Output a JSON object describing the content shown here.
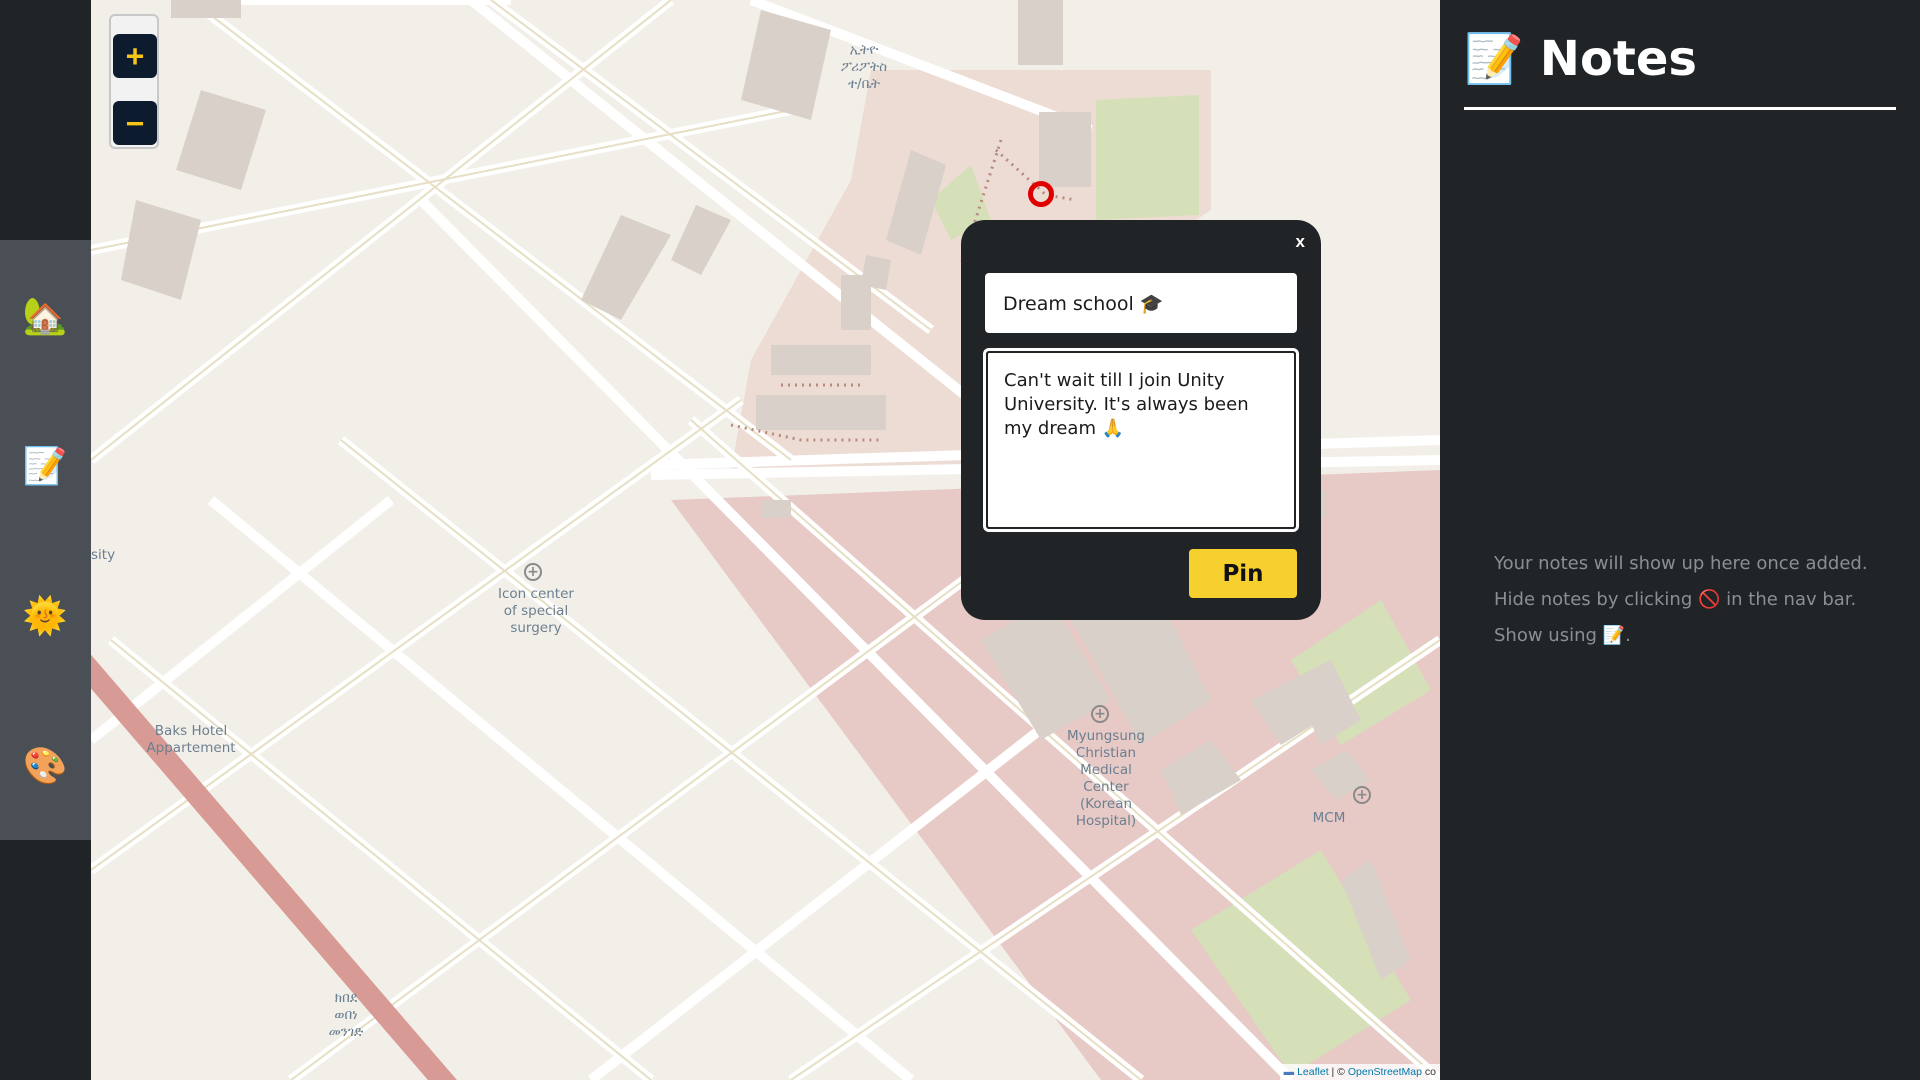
{
  "nav": {
    "items": [
      {
        "name": "home",
        "icon": "🏡"
      },
      {
        "name": "notes",
        "icon": "📝"
      },
      {
        "name": "theme",
        "icon": "🌞"
      },
      {
        "name": "palette",
        "icon": "🎨"
      }
    ]
  },
  "map": {
    "zoom_in_label": "+",
    "zoom_out_label": "−",
    "labels": {
      "amharic_top": "ኢትዮ\nፖሪፖትስ\nተ/ቤት",
      "icon_center": "Icon center\nof special\nsurgery",
      "baks_hotel": "Baks Hotel\nAppartement",
      "myungsung": "Myungsung\nChristian\nMedical\nCenter\n(Korean\nHospital)",
      "mcm": "MCM",
      "amharic_bottom": "ክበደ\nወበነ\nመንገድ",
      "university_partial": "sity"
    },
    "attribution": {
      "leaflet": "Leaflet",
      "separator": " | © ",
      "osm": "OpenStreetMap",
      "suffix": " co"
    }
  },
  "popup": {
    "close_label": "x",
    "title_value": "Dream school 🎓",
    "note_value": "Can't wait till I join Unity University. It's always been my dream 🙏",
    "pin_label": "Pin"
  },
  "panel": {
    "title_icon": "📝",
    "title": "Notes",
    "empty_line1": "Your notes will show up here once added.",
    "empty_line2_pre": "Hide notes by clicking ",
    "empty_line2_icon": "🚫",
    "empty_line2_post": " in the nav bar.",
    "empty_line3_pre": "Show using ",
    "empty_line3_icon": "📝",
    "empty_line3_post": "."
  },
  "colors": {
    "background": "#212427",
    "nav_band": "#4a4f55",
    "accent_yellow": "#f5d02e",
    "marker_red": "#e00000",
    "zoom_button": "#0d1b2e"
  }
}
